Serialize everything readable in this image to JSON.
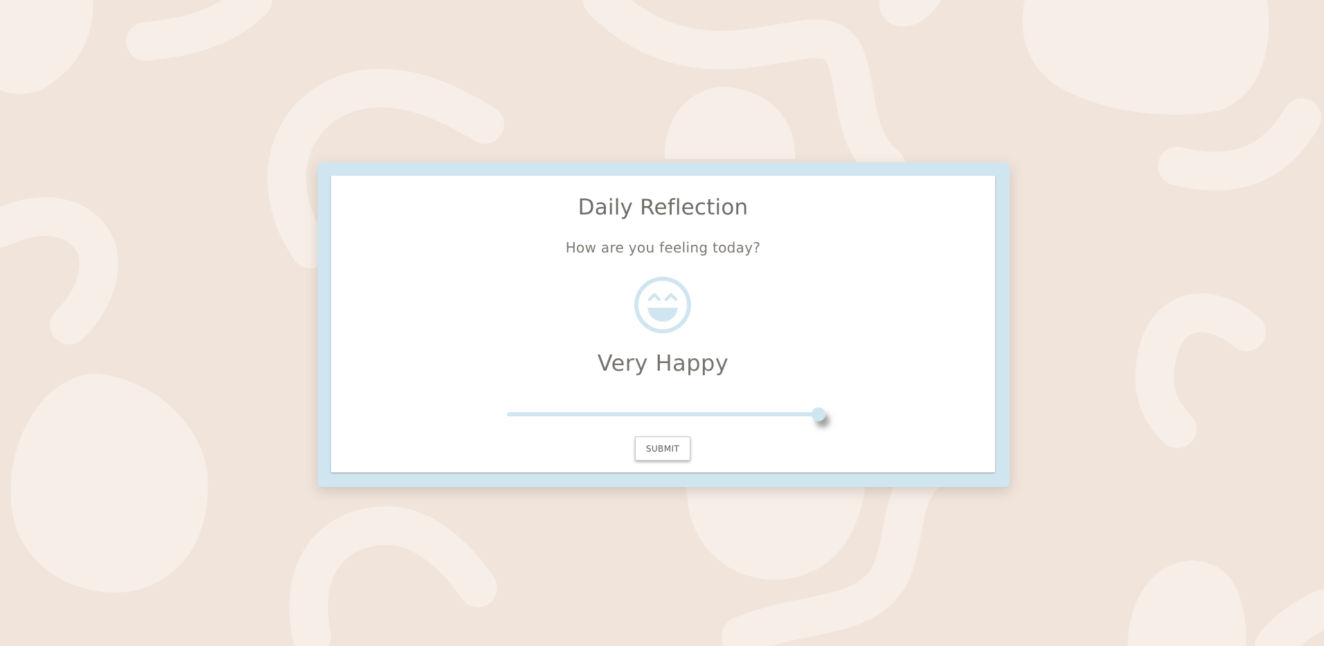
{
  "card": {
    "title": "Daily Reflection",
    "question": "How are you feeling today?",
    "mood_label": "Very Happy",
    "mood_icon": "smile-very-happy-icon",
    "submit_label": "SUBMIT"
  },
  "mood_slider": {
    "value_fraction": 1.0
  },
  "colors": {
    "background": "#f0e4db",
    "background_shapes": "#f7eee8",
    "accent": "#cfe6f0",
    "text": "#6f6b66"
  }
}
